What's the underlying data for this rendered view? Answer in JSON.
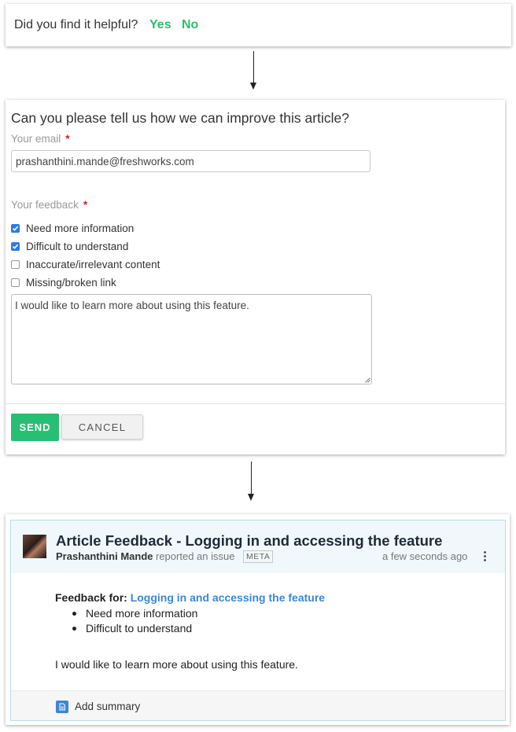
{
  "helpful_prompt": {
    "question": "Did you find it helpful?",
    "yes_label": "Yes",
    "no_label": "No"
  },
  "feedback_form": {
    "title": "Can you please tell us how we can improve this article?",
    "email_label": "Your email",
    "email_value": "prashanthini.mande@freshworks.com",
    "required_mark": "*",
    "feedback_label": "Your feedback",
    "options": [
      {
        "label": "Need more information",
        "checked": true
      },
      {
        "label": "Difficult to understand",
        "checked": true
      },
      {
        "label": "Inaccurate/irrelevant content",
        "checked": false
      },
      {
        "label": "Missing/broken link",
        "checked": false
      }
    ],
    "comment_value": "I would like to learn more about using this feature.",
    "send_label": "SEND",
    "cancel_label": "CANCEL",
    "send_color": "#27bf73"
  },
  "ticket": {
    "title": "Article Feedback - Logging in and accessing the feature",
    "author": "Prashanthini Mande",
    "action": "reported an issue",
    "badge": "META",
    "time": "a few seconds ago",
    "feedback_for_label": "Feedback for:",
    "article_link": "Logging in and accessing the feature",
    "items": [
      "Need more information",
      "Difficult to understand"
    ],
    "note": "I would like to learn more about using this feature.",
    "summary_label": "Add summary",
    "link_color": "#3d86d6"
  }
}
